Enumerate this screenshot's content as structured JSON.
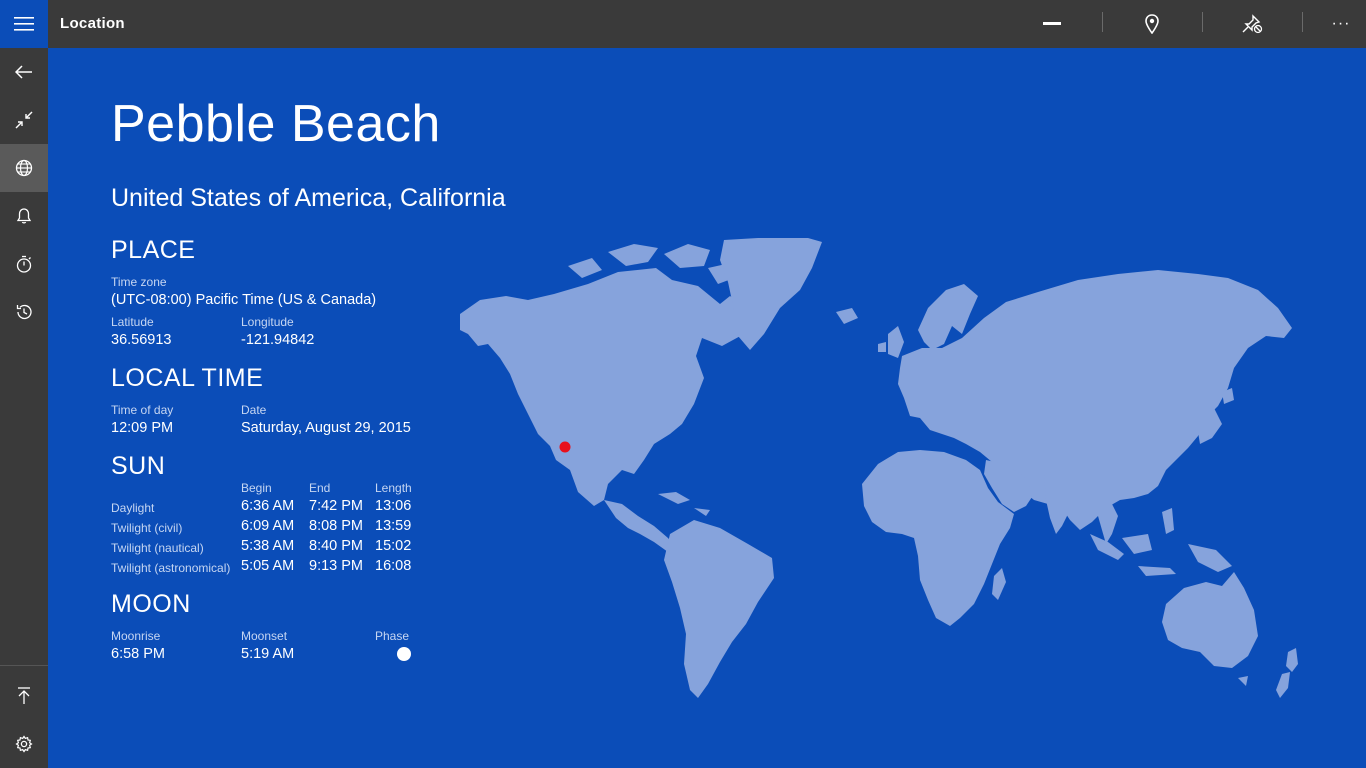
{
  "app": {
    "title": "Location"
  },
  "toolbar": {
    "buttons": [
      {
        "name": "minimize-button",
        "icon": "dash-icon"
      },
      {
        "name": "pin-location-button",
        "icon": "map-pin-icon"
      },
      {
        "name": "unpin-button",
        "icon": "unpin-icon"
      },
      {
        "name": "more-button",
        "icon": "more-icon",
        "label": "···"
      }
    ]
  },
  "sidebar": {
    "items": [
      {
        "name": "back",
        "icon": "back-arrow-icon"
      },
      {
        "name": "collapse",
        "icon": "collapse-icon"
      },
      {
        "name": "world",
        "icon": "globe-icon",
        "active": true
      },
      {
        "name": "alarm",
        "icon": "bell-icon"
      },
      {
        "name": "timer",
        "icon": "stopwatch-icon"
      },
      {
        "name": "history",
        "icon": "history-icon"
      }
    ],
    "bottom": [
      {
        "name": "pin-top",
        "icon": "pin-top-icon"
      },
      {
        "name": "settings",
        "icon": "gear-icon"
      }
    ]
  },
  "location": {
    "city": "Pebble Beach",
    "region": "United States of America, California"
  },
  "place": {
    "heading": "PLACE",
    "timezone_label": "Time zone",
    "timezone": "(UTC-08:00) Pacific Time (US & Canada)",
    "latitude_label": "Latitude",
    "latitude": "36.56913",
    "longitude_label": "Longitude",
    "longitude": "-121.94842"
  },
  "local_time": {
    "heading": "LOCAL TIME",
    "time_label": "Time of day",
    "time": "12:09 PM",
    "date_label": "Date",
    "date": "Saturday, August 29, 2015"
  },
  "sun": {
    "heading": "SUN",
    "columns": [
      "Begin",
      "End",
      "Length"
    ],
    "rows": [
      {
        "label": "Daylight",
        "begin": "6:36 AM",
        "end": "7:42 PM",
        "length": "13:06"
      },
      {
        "label": "Twilight (civil)",
        "begin": "6:09 AM",
        "end": "8:08 PM",
        "length": "13:59"
      },
      {
        "label": "Twilight (nautical)",
        "begin": "5:38 AM",
        "end": "8:40 PM",
        "length": "15:02"
      },
      {
        "label": "Twilight (astronomical)",
        "begin": "5:05 AM",
        "end": "9:13 PM",
        "length": "16:08"
      }
    ]
  },
  "moon": {
    "heading": "MOON",
    "moonrise_label": "Moonrise",
    "moonrise": "6:58 PM",
    "moonset_label": "Moonset",
    "moonset": "5:19 AM",
    "phase_label": "Phase",
    "phase": "full"
  },
  "colors": {
    "background": "#0b4db8",
    "bar": "#3a3a3a",
    "land": "#86a3dc",
    "marker": "#e8101c"
  }
}
